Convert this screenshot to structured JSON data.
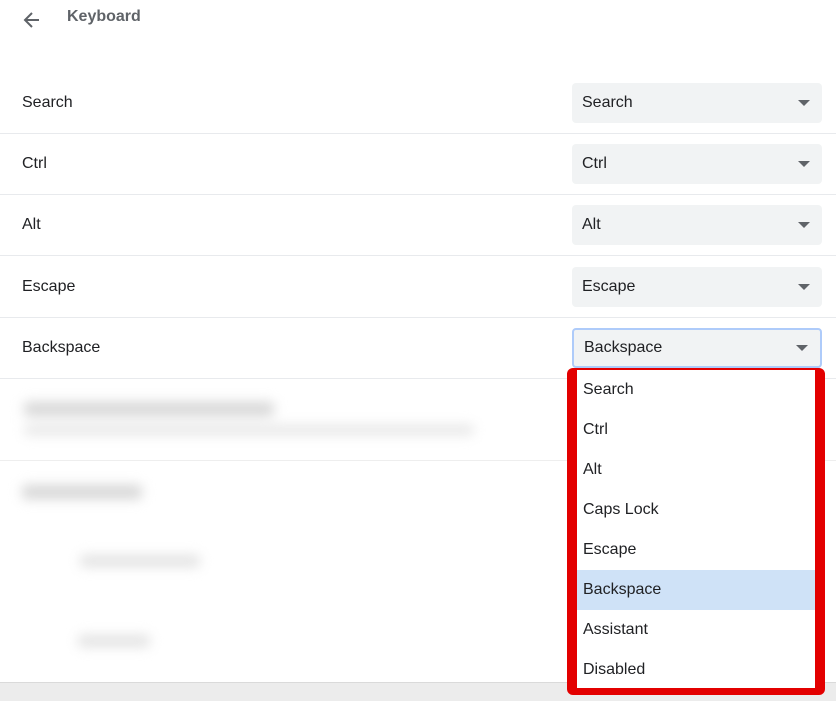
{
  "header": {
    "title": "Keyboard",
    "back_icon": "arrow-left-icon"
  },
  "rows": [
    {
      "label": "Search",
      "value": "Search"
    },
    {
      "label": "Ctrl",
      "value": "Ctrl"
    },
    {
      "label": "Alt",
      "value": "Alt"
    },
    {
      "label": "Escape",
      "value": "Escape"
    },
    {
      "label": "Backspace",
      "value": "Backspace"
    }
  ],
  "dropdown": {
    "options": [
      "Search",
      "Ctrl",
      "Alt",
      "Caps Lock",
      "Escape",
      "Backspace",
      "Assistant",
      "Disabled"
    ],
    "selected": "Backspace",
    "highlight_color": "#e30000"
  }
}
